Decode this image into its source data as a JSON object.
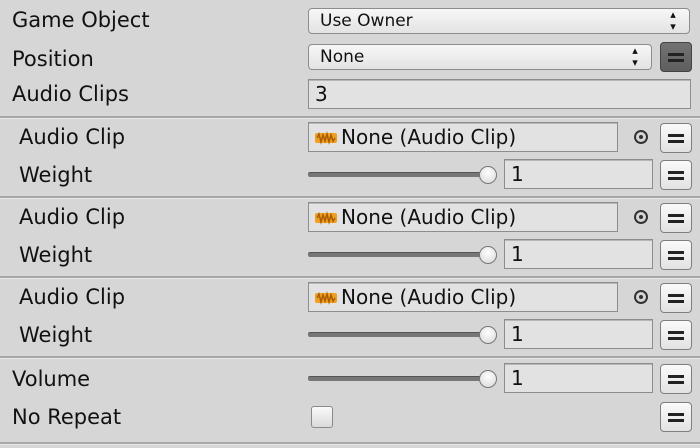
{
  "game_object": {
    "label": "Game Object",
    "selected": "Use Owner"
  },
  "position": {
    "label": "Position",
    "selected": "None"
  },
  "audio_clips": {
    "label": "Audio Clips",
    "count": "3",
    "items": [
      {
        "clip_label": "Audio Clip",
        "clip_value": "None (Audio Clip)",
        "weight_label": "Weight",
        "weight_value": "1"
      },
      {
        "clip_label": "Audio Clip",
        "clip_value": "None (Audio Clip)",
        "weight_label": "Weight",
        "weight_value": "1"
      },
      {
        "clip_label": "Audio Clip",
        "clip_value": "None (Audio Clip)",
        "weight_label": "Weight",
        "weight_value": "1"
      }
    ]
  },
  "volume": {
    "label": "Volume",
    "value": "1"
  },
  "no_repeat": {
    "label": "No Repeat",
    "checked": false
  },
  "icons": {
    "dropdown_arrows": "up-down-chevron",
    "audio_clip": "audio-clip-icon",
    "object_picker": "object-picker-icon",
    "menu": "menu-icon"
  },
  "colors": {
    "background": "#d6d6d6",
    "field": "#e2e2e2",
    "active_button": "#6a6a6a",
    "audio_icon": "#f0a020"
  }
}
